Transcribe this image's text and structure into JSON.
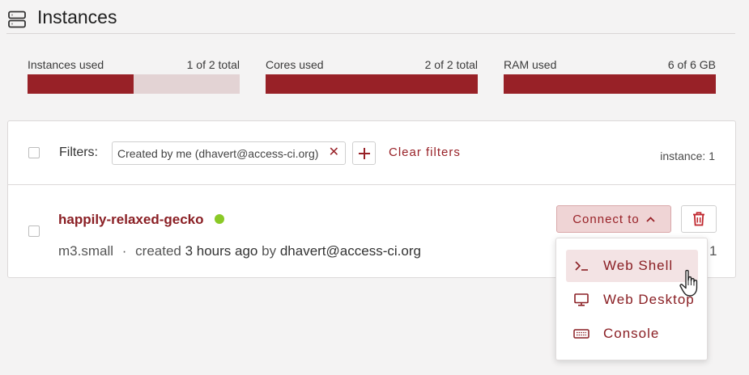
{
  "header": {
    "title": "Instances",
    "icon": "server-icon"
  },
  "usage": [
    {
      "label": "Instances used",
      "value": "1 of 2 total",
      "fraction": 0.5
    },
    {
      "label": "Cores used",
      "value": "2 of 2 total",
      "fraction": 1.0
    },
    {
      "label": "RAM used",
      "value": "6 of 6 GB",
      "fraction": 1.0
    }
  ],
  "filters": {
    "label": "Filters:",
    "chip_text": "Created by me (dhavert@access-ci.org)",
    "clear_label": "Clear filters",
    "instance_count": "instance: 1"
  },
  "instance": {
    "name": "happily-relaxed-gecko",
    "flavor": "m3.small",
    "separator": "·",
    "created_prefix": "created",
    "created_time": "3 hours ago",
    "by_word": "by",
    "owner": "dhavert@access-ci.org",
    "trailing": "1",
    "status_color": "#8ac926"
  },
  "actions": {
    "connect_label": "Connect to"
  },
  "connect_menu": [
    {
      "label": "Web Shell",
      "icon": "terminal-icon"
    },
    {
      "label": "Web Desktop",
      "icon": "monitor-icon"
    },
    {
      "label": "Console",
      "icon": "keyboard-icon"
    }
  ],
  "colors": {
    "accent": "#982127",
    "bar_bg": "#e3d3d4",
    "status_green": "#8ac926"
  }
}
